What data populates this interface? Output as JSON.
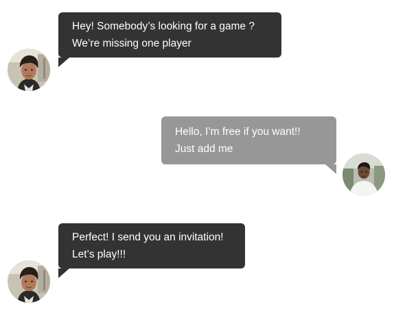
{
  "messages": [
    {
      "side": "left",
      "style": "dark",
      "lines": [
        "Hey! Somebody’s looking for a game ?",
        "We’re missing one player"
      ],
      "avatar": "boy-avatar"
    },
    {
      "side": "right",
      "style": "light",
      "lines": [
        "Hello, I’m free if you want!!",
        "Just add me"
      ],
      "avatar": "man-avatar"
    },
    {
      "side": "left",
      "style": "dark",
      "lines": [
        "Perfect! I send you an invitation!",
        "Let’s play!!!"
      ],
      "avatar": "boy-avatar"
    }
  ],
  "colors": {
    "dark_bubble": "#333333",
    "light_bubble": "#979797",
    "text": "#ffffff",
    "background": "#ffffff"
  }
}
